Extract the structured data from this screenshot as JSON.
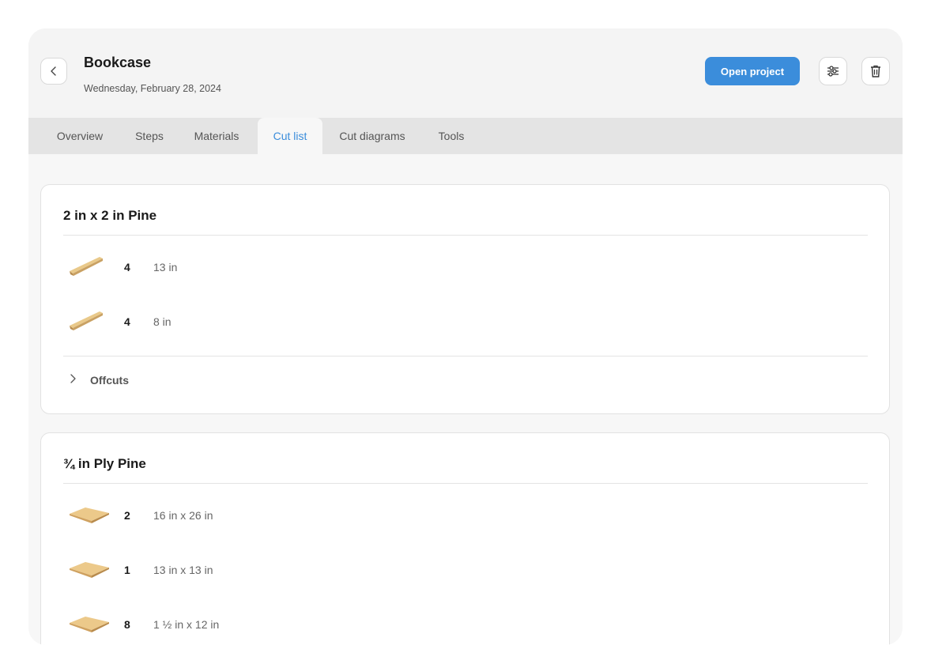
{
  "header": {
    "title": "Bookcase",
    "date": "Wednesday, February 28, 2024",
    "open_project_label": "Open project",
    "accent_color": "#3b8ddb"
  },
  "icons": {
    "back": "chevron-left-icon",
    "settings": "sliders-icon",
    "delete": "trash-icon"
  },
  "tabs": [
    {
      "label": "Overview",
      "active": false
    },
    {
      "label": "Steps",
      "active": false
    },
    {
      "label": "Materials",
      "active": false
    },
    {
      "label": "Cut list",
      "active": true
    },
    {
      "label": "Cut diagrams",
      "active": false
    },
    {
      "label": "Tools",
      "active": false
    }
  ],
  "materials": [
    {
      "title": "2 in x 2 in Pine",
      "thumb": "board-icon",
      "cuts": [
        {
          "qty": "4",
          "size": "13 in"
        },
        {
          "qty": "4",
          "size": "8 in"
        }
      ],
      "offcuts_label": "Offcuts"
    },
    {
      "title": "¾ in Ply Pine",
      "thumb": "sheet-icon",
      "cuts": [
        {
          "qty": "2",
          "size": "16 in x 26 in"
        },
        {
          "qty": "1",
          "size": "13 in x 13 in"
        },
        {
          "qty": "8",
          "size": "1 ½ in x 12 in"
        }
      ]
    }
  ]
}
